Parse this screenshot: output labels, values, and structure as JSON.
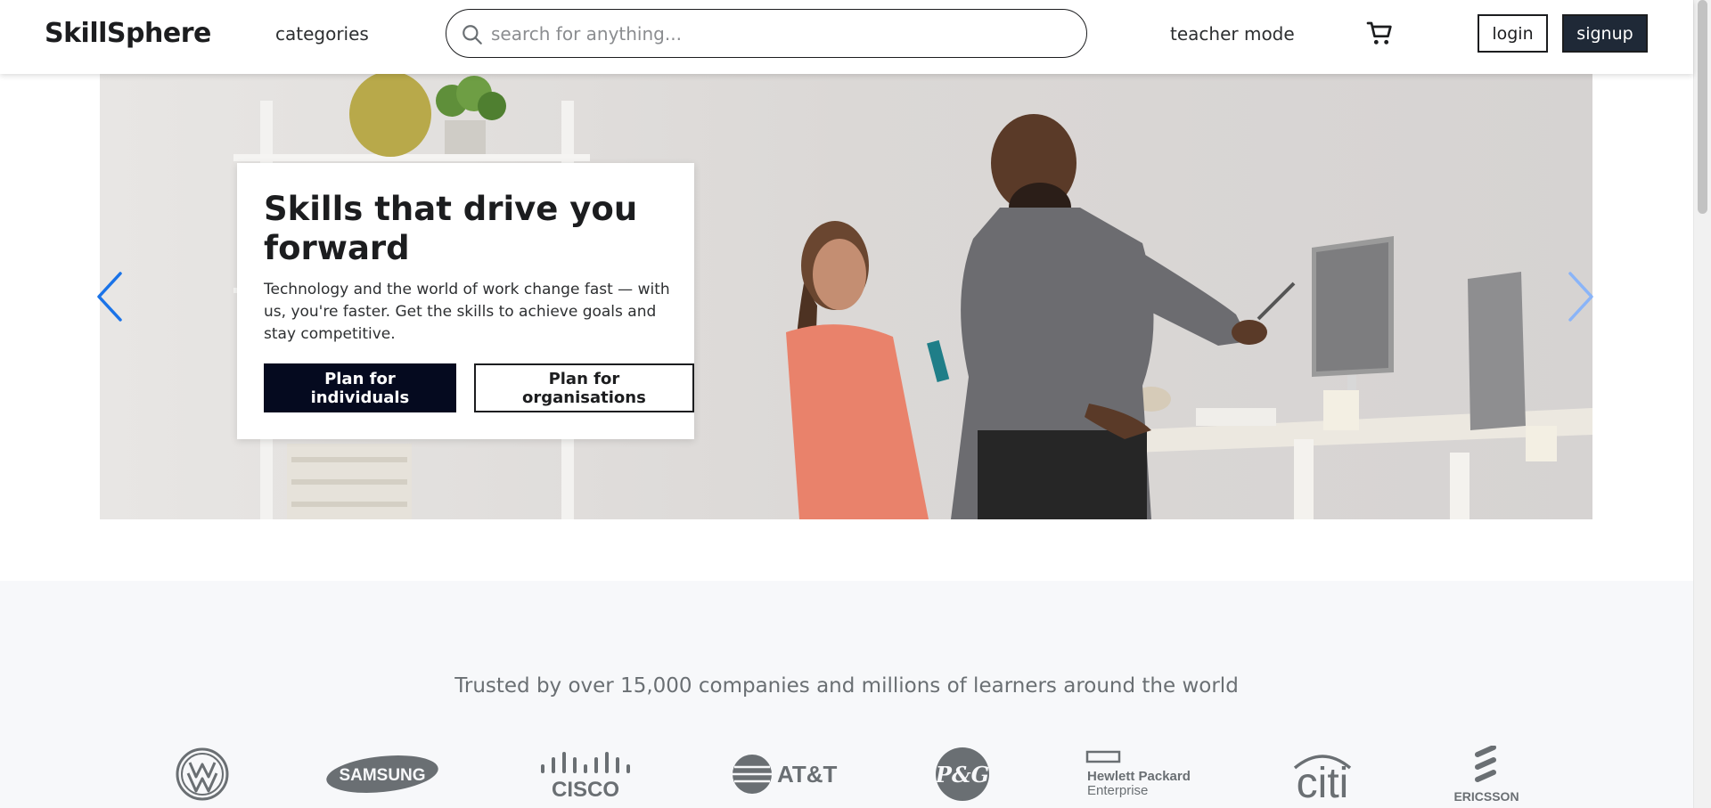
{
  "header": {
    "logo": "SkillSphere",
    "categories_label": "categories",
    "search_placeholder": "search for anything...",
    "search_value": "",
    "teacher_mode_label": "teacher mode",
    "login_label": "login",
    "signup_label": "signup"
  },
  "hero": {
    "title": "Skills that drive you forward",
    "description": "Technology and the world of work change fast — with us, you're faster. Get the skills to achieve goals and stay competitive.",
    "primary_button": "Plan for individuals",
    "secondary_button": "Plan for organisations"
  },
  "trusted": {
    "text": "Trusted by over 15,000 companies and millions of learners around the world",
    "logos": [
      "Volkswagen",
      "SAMSUNG",
      "CISCO",
      "AT&T",
      "P&G",
      "Hewlett Packard Enterprise",
      "citi",
      "ERICSSON"
    ]
  },
  "colors": {
    "primary_dark": "#050a1f",
    "signup_bg": "#1f2937",
    "arrow_left": "#1a73e8",
    "arrow_right": "#8ab4f8",
    "logo_gray": "#6a6f73",
    "trusted_bg": "#f7f8fa"
  },
  "icons": {
    "search": "search-icon",
    "cart": "cart-icon",
    "prev": "chevron-left-icon",
    "next": "chevron-right-icon"
  }
}
